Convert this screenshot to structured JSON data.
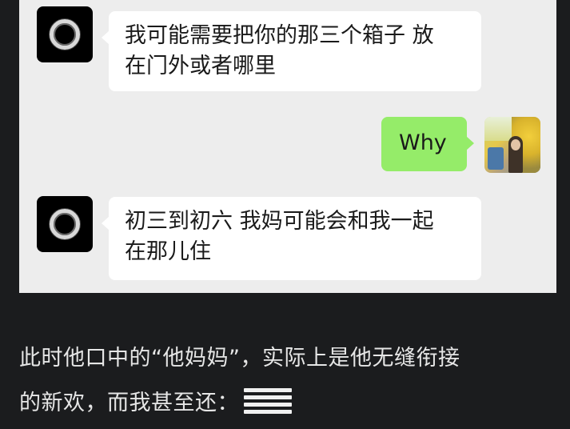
{
  "chat": {
    "messages": [
      {
        "side": "left",
        "text_line1": "我可能需要把你的那三个箱子 放",
        "text_line2": "在门外或者哪里"
      },
      {
        "side": "right",
        "text": "Why"
      },
      {
        "side": "left",
        "text_line1": "初三到初六 我妈可能会和我一起",
        "text_line2": "在那儿住"
      }
    ],
    "left_avatar_icon": "ring-avatar-icon",
    "right_avatar_icon": "photo-avatar"
  },
  "caption": {
    "line1": "此时他口中的“他妈妈”，实际上是他无缝衔接",
    "line2": "的新欢，而我甚至还：",
    "trailing_icon": "speechless-lines-icon"
  },
  "colors": {
    "page_bg": "#1b1c1e",
    "chat_bg": "#ededed",
    "bubble_left": "#ffffff",
    "bubble_right": "#95ec69",
    "caption_text": "#e6e6e6"
  }
}
